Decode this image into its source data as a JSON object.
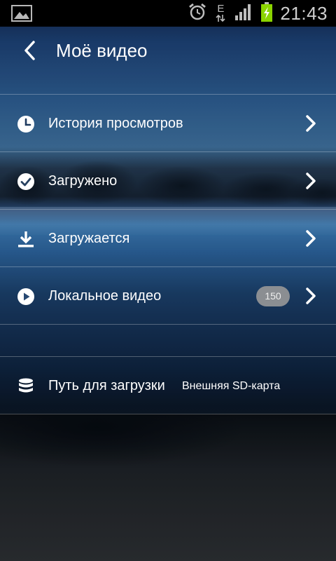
{
  "status_bar": {
    "time": "21:43",
    "network_label": "E",
    "icons": [
      "gallery-icon",
      "alarm-icon",
      "data-e-icon",
      "signal-icon",
      "battery-charging-icon"
    ]
  },
  "action_bar": {
    "title": "Моё видео",
    "back_icon": "chevron-left-icon"
  },
  "menu": {
    "items": [
      {
        "label": "История просмотров",
        "icon": "clock-icon"
      },
      {
        "label": "Загружено",
        "icon": "check-circle-icon"
      },
      {
        "label": "Загружается",
        "icon": "download-icon"
      },
      {
        "label": "Локальное видео",
        "icon": "play-circle-icon",
        "badge": "150"
      }
    ]
  },
  "settings": {
    "download_path": {
      "label": "Путь для загрузки",
      "value": "Внешняя SD-карта",
      "icon": "storage-icon"
    }
  },
  "colors": {
    "text": "#ffffff",
    "divider": "rgba(255,255,255,0.28)",
    "badge_bg": "#8b8e92",
    "status_bar_bg": "#000000"
  }
}
